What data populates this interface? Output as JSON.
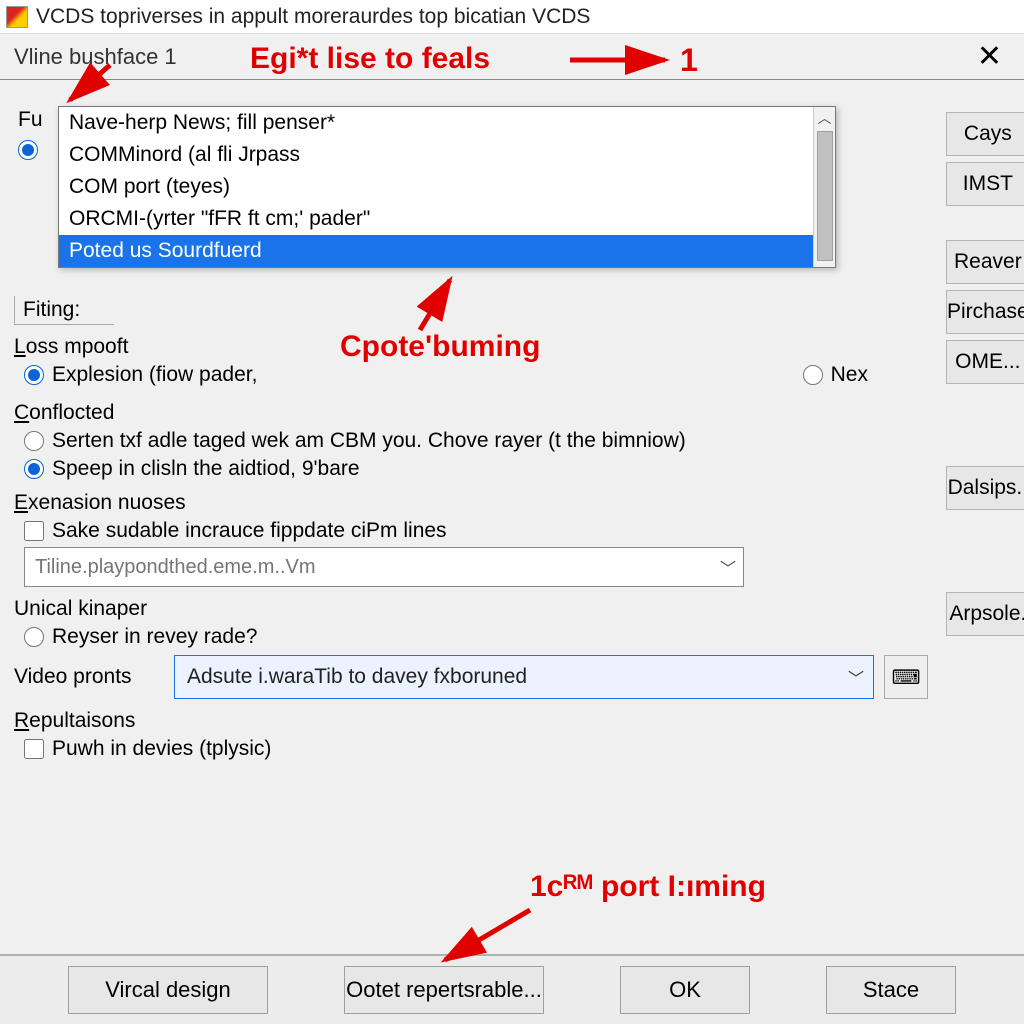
{
  "titlebar": {
    "title": "VCDS topriverses in appult moreraurdes top bicatian VCDS"
  },
  "subbar": {
    "title": "Vline bushface 1"
  },
  "dropdown": {
    "items": [
      "Nave-herp News; fill penser*",
      "COMMinord (al fli Jrpass",
      "COM port (teyes)",
      "ORCMI-(yrter \"fFR ft cm;' pader\"",
      "Poted us Sourdfuerd"
    ],
    "selected_index": 4
  },
  "left": {
    "fu_prefix": "Fu",
    "field1_label": "Fiting:",
    "loss_label": "Loss mpooft",
    "explesion_label": "Explesion (fiow pader,",
    "nex_label": "Nex",
    "conflocted_label": "Conflocted",
    "conflocted_opt1": "Serten txf adle taged wek am CBM you. Chove rayer (t the bimniow)",
    "conflocted_opt2": "Speep in clisln the aidtiod, 9'bare",
    "exen_label": "Exenasion nuoses",
    "exen_check": "Sake sudable incrauce fippdate ciPm lines",
    "exen_placeholder": "Tiline.playpondthed.eme.m..Vm",
    "unical_label": "Unical kinaper",
    "unical_radio": "Reyser in revey rade?",
    "video_label": "Video pronts",
    "video_value": "Adsute i.waraTib to davey fxboruned",
    "reput_label": "Repultaisons",
    "reput_check": "Puwh in devies (tplysic)"
  },
  "right_buttons": [
    "Cays",
    "IMST",
    "Reaver",
    "Pirchase",
    "OME...",
    "Dalsips..",
    "Arpsole."
  ],
  "bottom": {
    "b1": "Vircal design",
    "b2": "Ootet repertsrable...",
    "b3": "OK",
    "b4": "Stace"
  },
  "annotations": {
    "a1": "Egi*t lise to feals",
    "a1_arrow_end": "1",
    "a2": "Cpote'buming",
    "a3": "1cᴿᴹ port I:ıming"
  }
}
